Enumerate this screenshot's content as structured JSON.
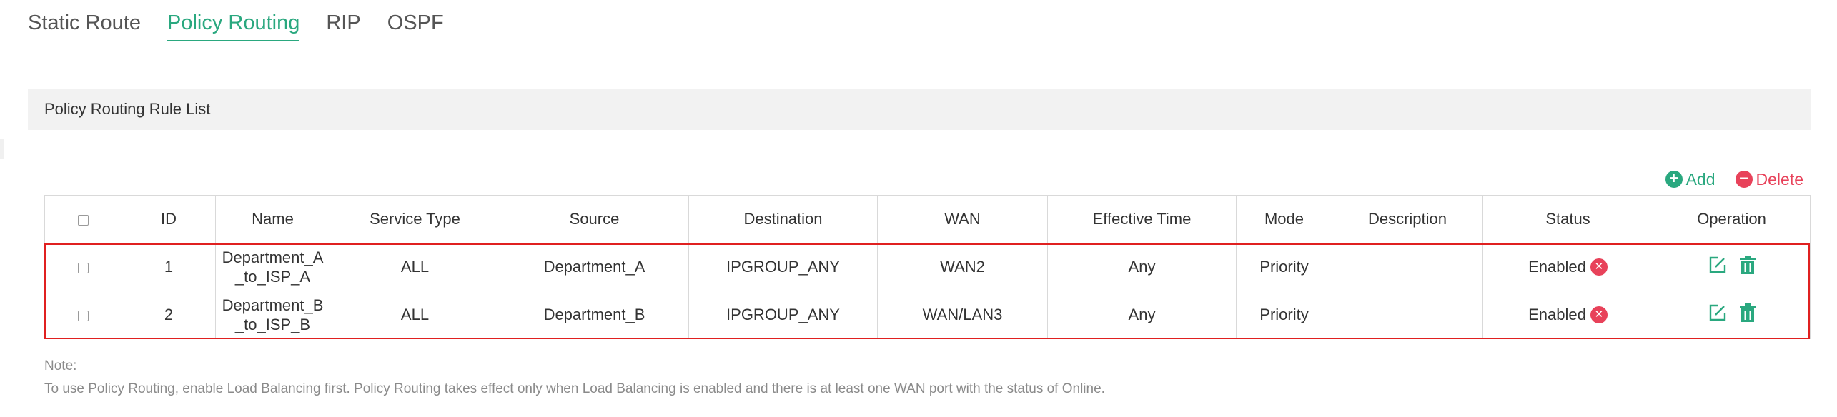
{
  "tabs": [
    {
      "label": "Static Route",
      "active": false
    },
    {
      "label": "Policy Routing",
      "active": true
    },
    {
      "label": "RIP",
      "active": false
    },
    {
      "label": "OSPF",
      "active": false
    }
  ],
  "section": {
    "title": "Policy Routing Rule List"
  },
  "toolbar": {
    "add_label": "Add",
    "delete_label": "Delete"
  },
  "table": {
    "headers": [
      "ID",
      "Name",
      "Service Type",
      "Source",
      "Destination",
      "WAN",
      "Effective Time",
      "Mode",
      "Description",
      "Status",
      "Operation"
    ],
    "rows": [
      {
        "id": "1",
        "name": "Department_A_to_ISP_A",
        "service_type": "ALL",
        "source": "Department_A",
        "destination": "IPGROUP_ANY",
        "wan": "WAN2",
        "effective_time": "Any",
        "mode": "Priority",
        "description": "",
        "status": "Enabled"
      },
      {
        "id": "2",
        "name": "Department_B_to_ISP_B",
        "service_type": "ALL",
        "source": "Department_B",
        "destination": "IPGROUP_ANY",
        "wan": "WAN/LAN3",
        "effective_time": "Any",
        "mode": "Priority",
        "description": "",
        "status": "Enabled"
      }
    ]
  },
  "note": {
    "label": "Note:",
    "text": "To use Policy Routing, enable Load Balancing first. Policy Routing takes effect only when Load Balancing is enabled and there is at least one WAN port with the status of Online."
  },
  "colors": {
    "accent": "#2aa87f",
    "danger": "#e8425a",
    "highlight": "#e02020",
    "section_bg": "#f2f2f2"
  },
  "icons": {
    "add": "plus-circle-icon",
    "delete": "minus-circle-icon",
    "status": "x-circle-icon",
    "edit": "edit-icon",
    "trash": "trash-icon"
  }
}
